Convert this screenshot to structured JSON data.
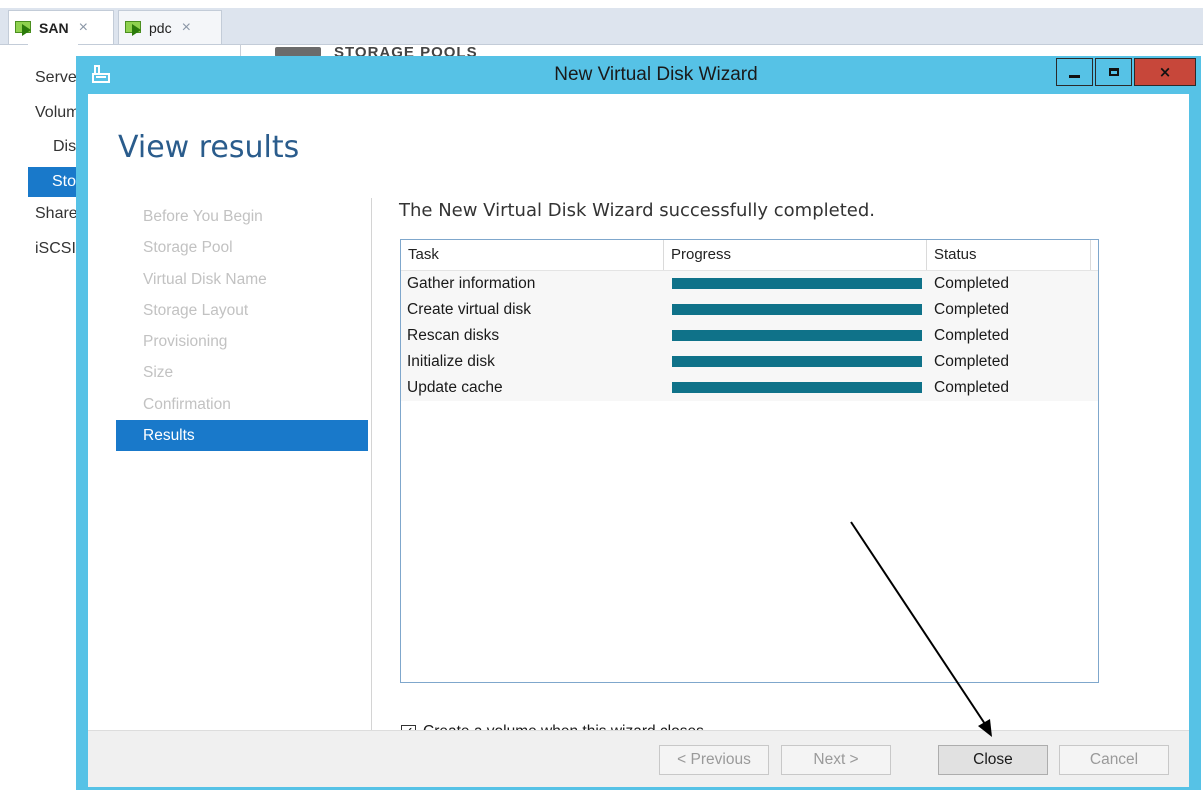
{
  "vm_tabs": [
    {
      "label": "SAN",
      "close": "×",
      "icon": "vm-connect-icon"
    },
    {
      "label": "pdc",
      "close": "×",
      "icon": "vm-connect-icon"
    }
  ],
  "server_manager": {
    "nav_items": [
      "Servers",
      "Volumes",
      "Disks",
      "Storage Pools",
      "Shares",
      "iSCSI"
    ],
    "section_header": "STORAGE POOLS"
  },
  "wizard": {
    "title": "New Virtual Disk Wizard",
    "icon": "wizard-disk-icon",
    "window_buttons": {
      "minimize": "minimize-icon",
      "maximize": "maximize-icon",
      "close": "×"
    },
    "heading": "View results",
    "steps": [
      "Before You Begin",
      "Storage Pool",
      "Virtual Disk Name",
      "Storage Layout",
      "Provisioning",
      "Size",
      "Confirmation",
      "Results"
    ],
    "current_step": "Results",
    "success_message": "The New Virtual Disk Wizard successfully completed.",
    "table": {
      "columns": [
        "Task",
        "Progress",
        "Status"
      ],
      "rows": [
        {
          "task": "Gather information",
          "progress": 1.0,
          "status": "Completed"
        },
        {
          "task": "Create virtual disk",
          "progress": 1.0,
          "status": "Completed"
        },
        {
          "task": "Rescan disks",
          "progress": 1.0,
          "status": "Completed"
        },
        {
          "task": "Initialize disk",
          "progress": 1.0,
          "status": "Completed"
        },
        {
          "task": "Update cache",
          "progress": 1.0,
          "status": "Completed"
        }
      ]
    },
    "checkbox": {
      "label": "Create a volume when this wizard closes",
      "checked": true,
      "glyph": "✓"
    },
    "buttons": {
      "previous": "< Previous",
      "next": "Next >",
      "close": "Close",
      "cancel": "Cancel"
    }
  },
  "colors": {
    "window_frame": "#56c2e6",
    "selection": "#1979ca",
    "progress_fill": "#0f7289",
    "close_button": "#c7473a",
    "heading_text": "#2a5c8c"
  }
}
